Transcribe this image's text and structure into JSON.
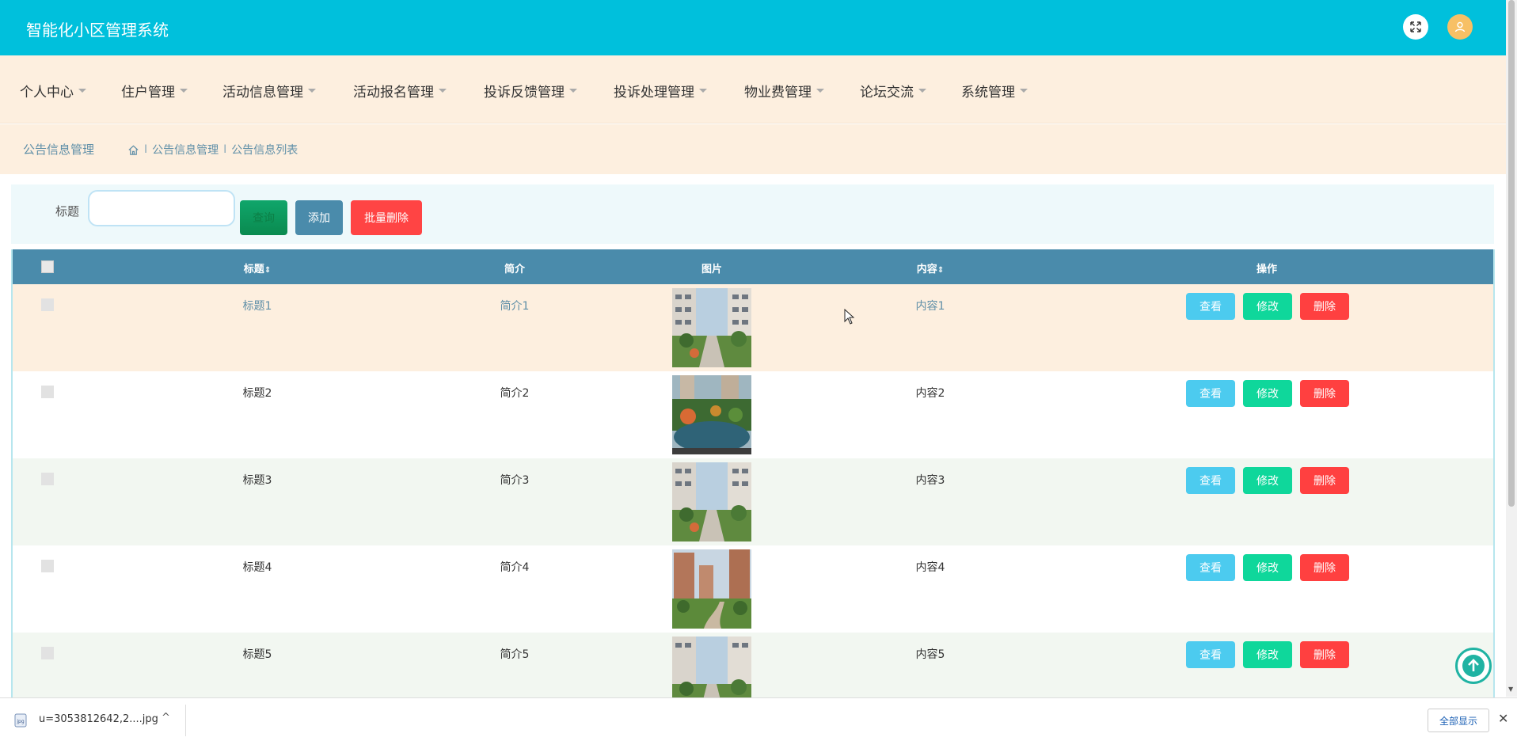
{
  "app": {
    "title": "智能化小区管理系统"
  },
  "header": {
    "fullscreen_icon": "fullscreen-icon",
    "avatar_icon": "user-icon"
  },
  "menu": [
    {
      "label": "个人中心"
    },
    {
      "label": "住户管理"
    },
    {
      "label": "活动信息管理"
    },
    {
      "label": "活动报名管理"
    },
    {
      "label": "投诉反馈管理"
    },
    {
      "label": "投诉处理管理"
    },
    {
      "label": "物业费管理"
    },
    {
      "label": "论坛交流"
    },
    {
      "label": "系统管理"
    }
  ],
  "breadcrumb": {
    "page_title": "公告信息管理",
    "home_icon": "home-icon",
    "sep": "I",
    "crumb1": "公告信息管理",
    "crumb2": "公告信息列表"
  },
  "search": {
    "label": "标题",
    "value": "",
    "search_label": "查询",
    "add_label": "添加",
    "batch_delete_label": "批量删除"
  },
  "table": {
    "columns": {
      "title": "标题",
      "summary": "简介",
      "image": "图片",
      "content": "内容",
      "actions": "操作"
    },
    "sort_glyph": "⇕",
    "actions": {
      "view": "查看",
      "edit": "修改",
      "delete": "删除"
    },
    "rows": [
      {
        "title": "标题1",
        "summary": "简介1",
        "content": "内容1",
        "image": "building-walkway"
      },
      {
        "title": "标题2",
        "summary": "简介2",
        "content": "内容2",
        "image": "garden-pond"
      },
      {
        "title": "标题3",
        "summary": "简介3",
        "content": "内容3",
        "image": "building-walkway"
      },
      {
        "title": "标题4",
        "summary": "简介4",
        "content": "内容4",
        "image": "towers-path"
      },
      {
        "title": "标题5",
        "summary": "简介5",
        "content": "内容5",
        "image": "building-walkway"
      }
    ]
  },
  "downloads": {
    "file_name": "u=3053812642,2....jpg",
    "show_all": "全部显示",
    "close": "✕",
    "chevron": "^"
  },
  "colors": {
    "header_bg": "#00c0dc",
    "menu_bg": "#fdefdf",
    "table_head": "#4a8bab",
    "row_highlight": "#fdefdf",
    "row_alt": "#f2f7f1",
    "view_btn": "#4ccbef",
    "edit_btn": "#0fd79b",
    "delete_btn": "#ff4040"
  }
}
